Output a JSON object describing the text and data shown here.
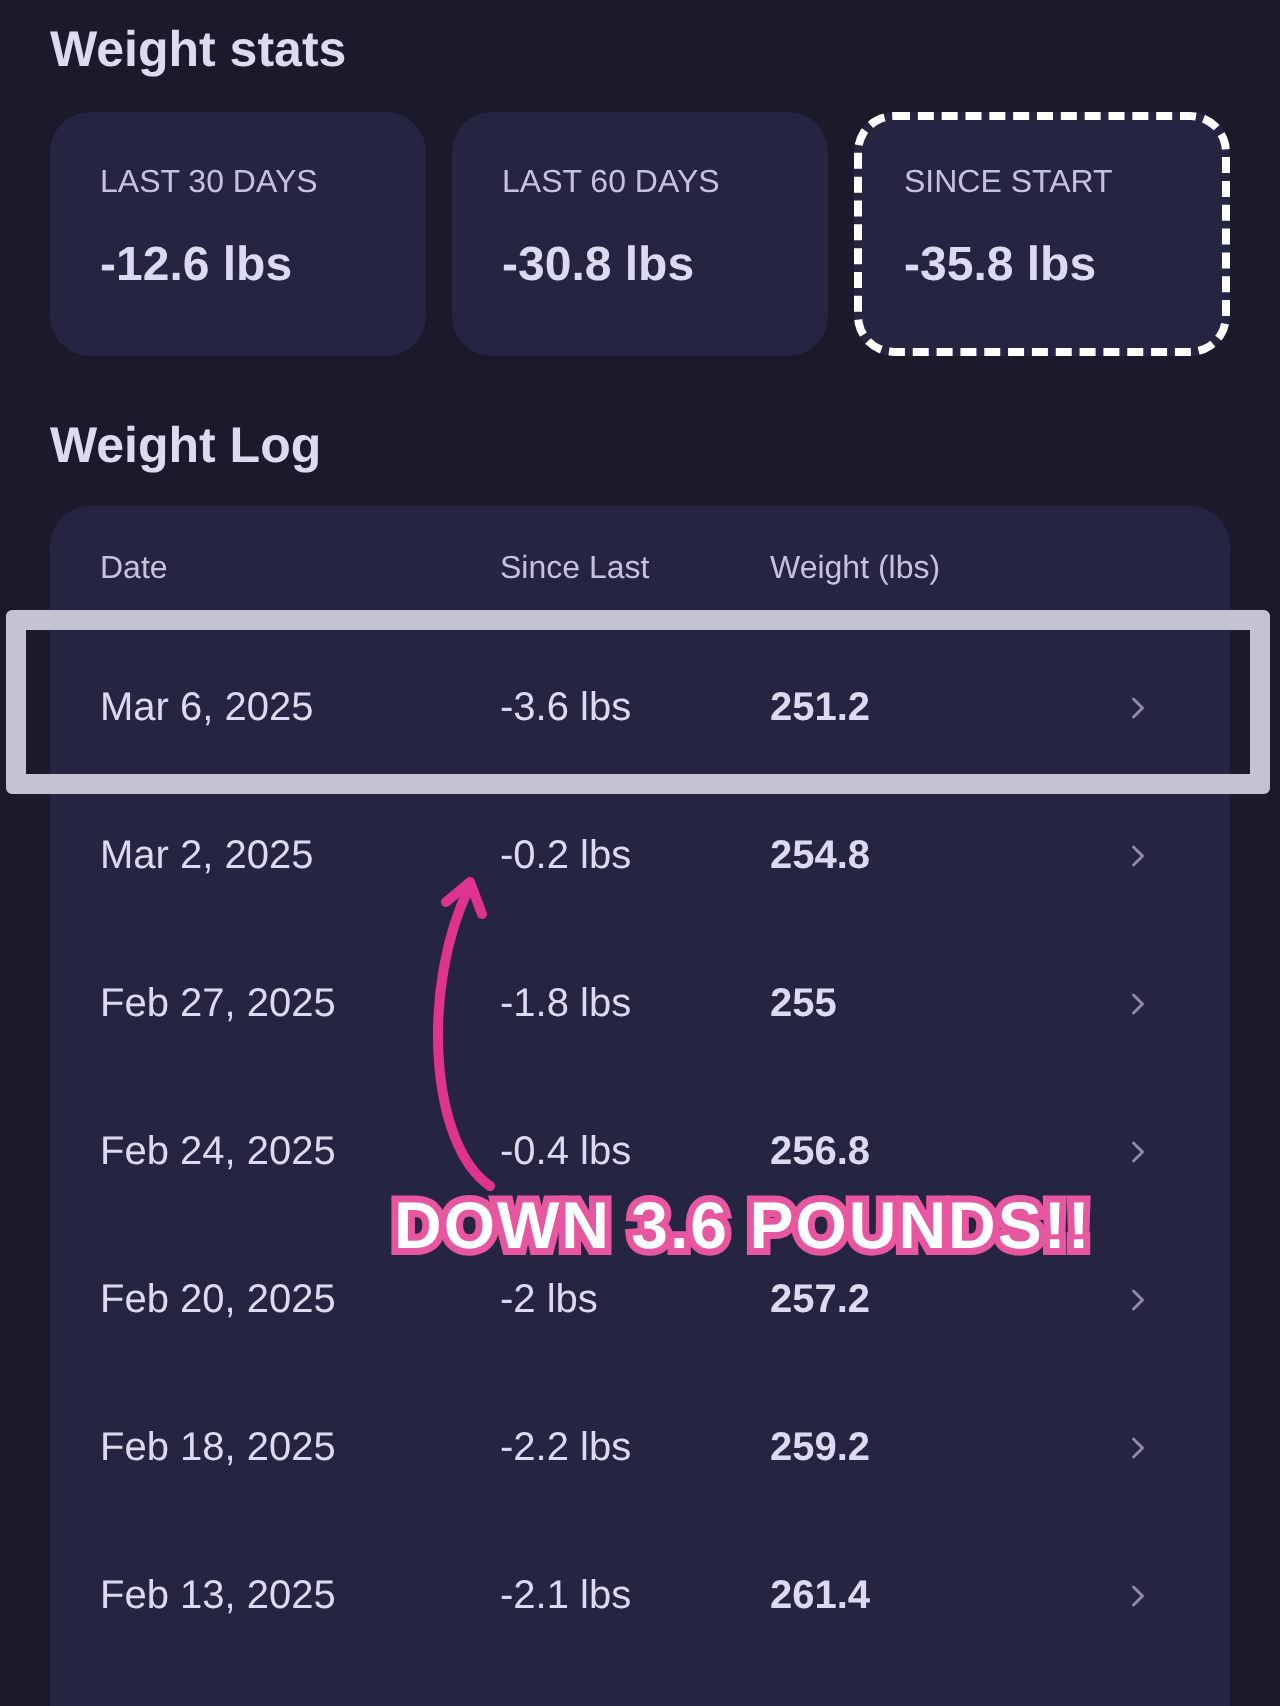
{
  "stats": {
    "title": "Weight stats",
    "cards": [
      {
        "label": "LAST 30 DAYS",
        "value": "-12.6 lbs",
        "circled": false
      },
      {
        "label": "LAST 60 DAYS",
        "value": "-30.8 lbs",
        "circled": false
      },
      {
        "label": "SINCE START",
        "value": "-35.8 lbs",
        "circled": true
      }
    ]
  },
  "log": {
    "title": "Weight Log",
    "columns": [
      "Date",
      "Since Last",
      "Weight (lbs)"
    ],
    "rows": [
      {
        "date": "Mar 6, 2025",
        "since_last": "-3.6 lbs",
        "weight": "251.2",
        "circled": true
      },
      {
        "date": "Mar 2, 2025",
        "since_last": "-0.2 lbs",
        "weight": "254.8",
        "circled": false
      },
      {
        "date": "Feb 27, 2025",
        "since_last": "-1.8 lbs",
        "weight": "255",
        "circled": false
      },
      {
        "date": "Feb 24, 2025",
        "since_last": "-0.4 lbs",
        "weight": "256.8",
        "circled": false
      },
      {
        "date": "Feb 20, 2025",
        "since_last": "-2 lbs",
        "weight": "257.2",
        "circled": false
      },
      {
        "date": "Feb 18, 2025",
        "since_last": "-2.2 lbs",
        "weight": "259.2",
        "circled": false
      },
      {
        "date": "Feb 13, 2025",
        "since_last": "-2.1 lbs",
        "weight": "261.4",
        "circled": false
      }
    ]
  },
  "callout": {
    "text": "DOWN 3.6 POUNDS!!"
  }
}
